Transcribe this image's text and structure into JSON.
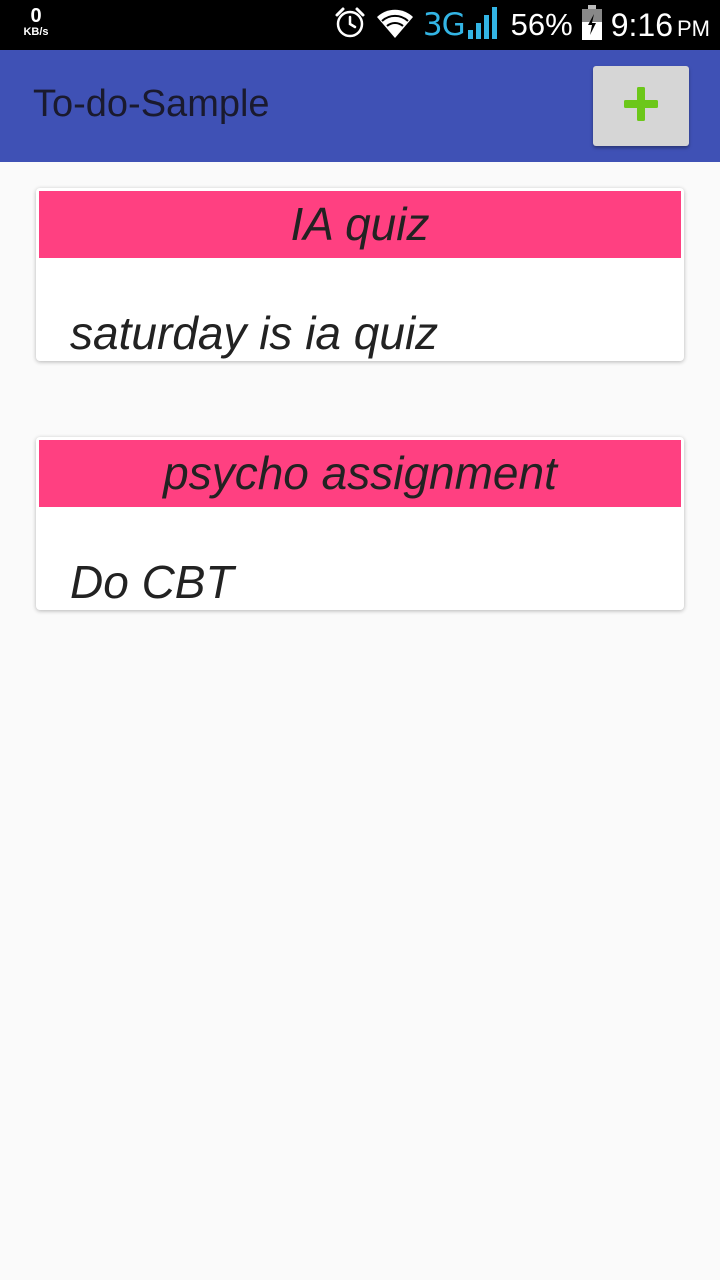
{
  "status_bar": {
    "net_speed_value": "0",
    "net_speed_unit": "KB/s",
    "network_type": "3G",
    "battery_percent": "56%",
    "time": "9:16",
    "ampm": "PM",
    "icons": [
      "alarm-icon",
      "wifi-icon",
      "signal-icon",
      "battery-icon"
    ]
  },
  "app_bar": {
    "title": "To-do-Sample",
    "add_button_icon": "plus-icon",
    "colors": {
      "app_bar": "#3f51b5",
      "add_button_bg": "#d6d6d6",
      "plus": "#6cc71a"
    }
  },
  "todos": [
    {
      "title": "IA quiz",
      "description": "saturday is ia quiz"
    },
    {
      "title": "psycho assignment",
      "description": "Do CBT"
    }
  ],
  "colors": {
    "card_header": "#ff4081",
    "background": "#fafafa"
  }
}
